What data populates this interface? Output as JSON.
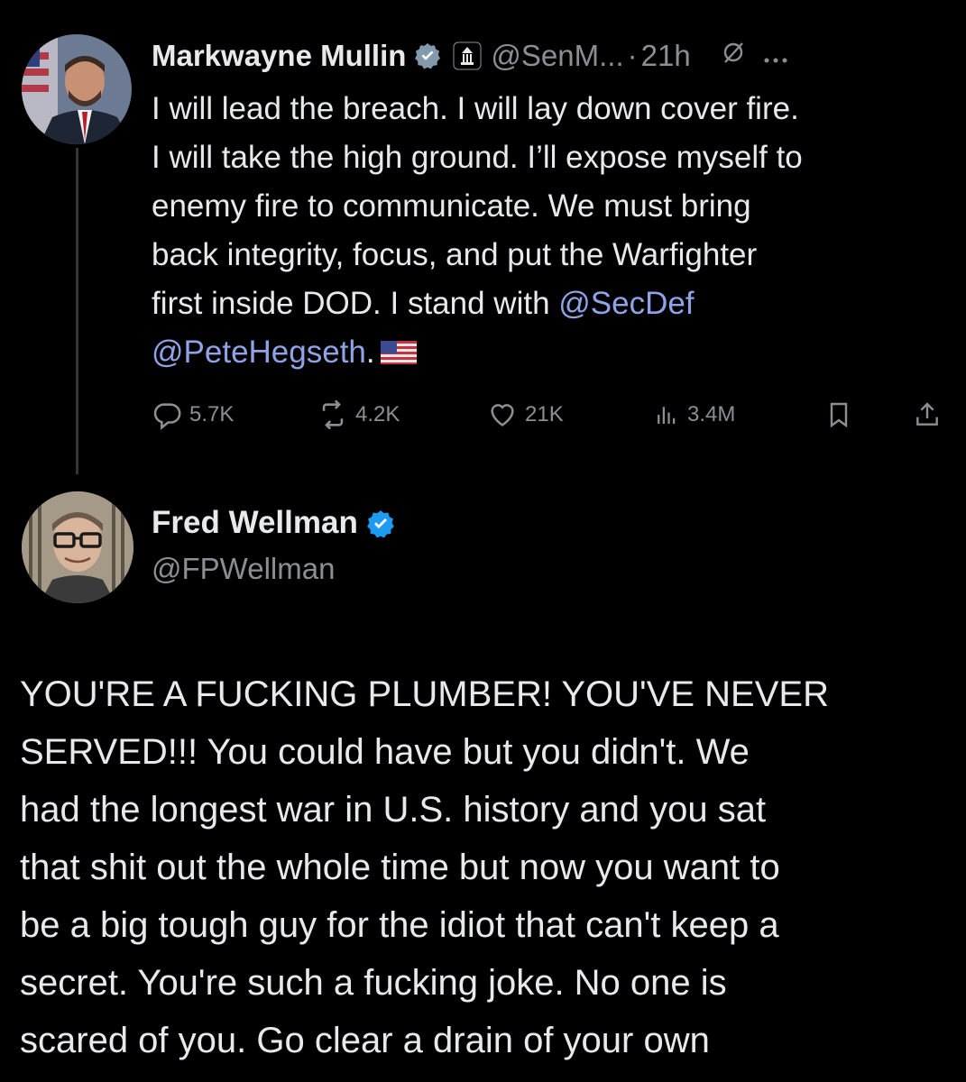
{
  "tweet1": {
    "author_name": "Markwayne Mullin",
    "handle": "@SenM...",
    "separator": "·",
    "time": "21h",
    "text_line1": "I will lead the breach. I will lay down cover fire.",
    "text_line2": "I will take the high ground. I’ll expose myself to",
    "text_line3": "enemy fire to communicate. We must bring",
    "text_line4": "back integrity, focus, and put the Warfighter",
    "text_line5_pre": "first inside DOD. I stand with ",
    "mention1": "@SecDef",
    "mention2": "@PeteHegseth",
    "mention2_suffix": ".",
    "replies": "5.7K",
    "reposts": "4.2K",
    "likes": "21K",
    "views": "3.4M",
    "icons": [
      "verified-badge-icon",
      "government-badge-icon",
      "grok-icon",
      "more-icon",
      "reply-icon",
      "repost-icon",
      "like-icon",
      "views-icon",
      "bookmark-icon",
      "share-icon",
      "us-flag-emoji"
    ]
  },
  "tweet2": {
    "author_name": "Fred Wellman",
    "handle": "@FPWellman",
    "text_lines": [
      "YOU'RE A FUCKING PLUMBER! YOU'VE NEVER",
      "SERVED!!! You could have but you didn't.  We",
      "had the longest war in U.S. history and you sat",
      "that shit out the whole time but now you want to",
      "be a big tough guy for the idiot that can't keep a",
      "secret. You're such a fucking joke. No one is",
      "scared of you. Go clear a drain of your own"
    ]
  },
  "colors": {
    "background": "#000000",
    "text": "#e7e9ea",
    "muted": "#8b8f94",
    "mention": "#8fa3e6",
    "verified_blue": "#1d9bf0",
    "verified_gray": "#829aab",
    "thread_line": "#333639"
  }
}
